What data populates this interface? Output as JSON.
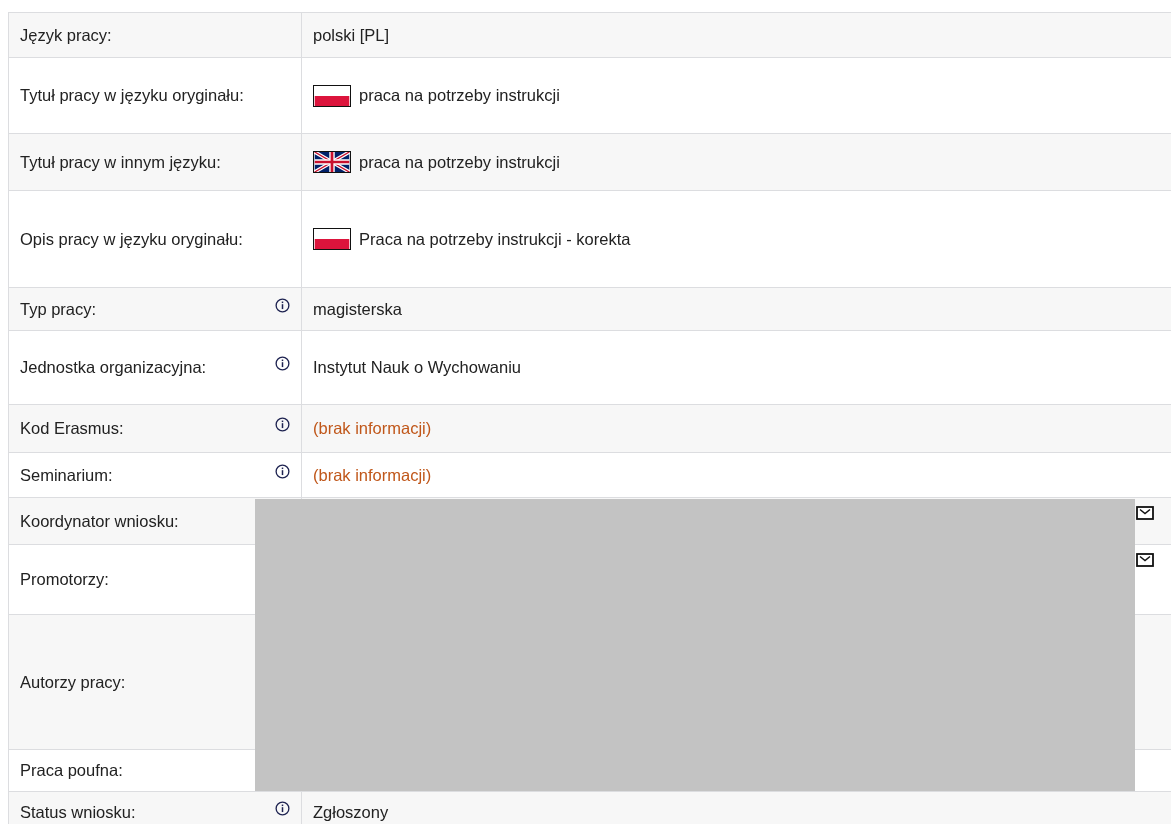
{
  "rows": [
    {
      "label": "Język pracy:",
      "info": false,
      "kind": "text",
      "value": "polski [PL]"
    },
    {
      "label": "Tytuł pracy w języku oryginału:",
      "info": false,
      "kind": "pl-flag",
      "value": "praca na potrzeby instrukcji"
    },
    {
      "label": "Tytuł pracy w innym języku:",
      "info": false,
      "kind": "gb-flag",
      "value": "praca na potrzeby instrukcji"
    },
    {
      "label": "Opis pracy w języku oryginału:",
      "info": false,
      "kind": "pl-flag",
      "value": "Praca na potrzeby instrukcji - korekta"
    },
    {
      "label": "Typ pracy:",
      "info": true,
      "kind": "text",
      "value": "magisterska"
    },
    {
      "label": "Jednostka organizacyjna:",
      "info": true,
      "kind": "text",
      "value": "Instytut Nauk o Wychowaniu"
    },
    {
      "label": "Kod Erasmus:",
      "info": true,
      "kind": "missing",
      "value": "(brak informacji)"
    },
    {
      "label": "Seminarium:",
      "info": true,
      "kind": "missing",
      "value": "(brak informacji)"
    },
    {
      "label": "Koordynator wniosku:",
      "info": false,
      "kind": "redacted",
      "mail": true
    },
    {
      "label": "Promotorzy:",
      "info": false,
      "kind": "redacted",
      "mail": true
    },
    {
      "label": "Autorzy pracy:",
      "info": false,
      "kind": "redacted",
      "mail": false
    },
    {
      "label": "Praca poufna:",
      "info": false,
      "kind": "redacted",
      "mail": false
    },
    {
      "label": "Status wniosku:",
      "info": true,
      "kind": "text",
      "value": "Zgłoszony"
    }
  ]
}
